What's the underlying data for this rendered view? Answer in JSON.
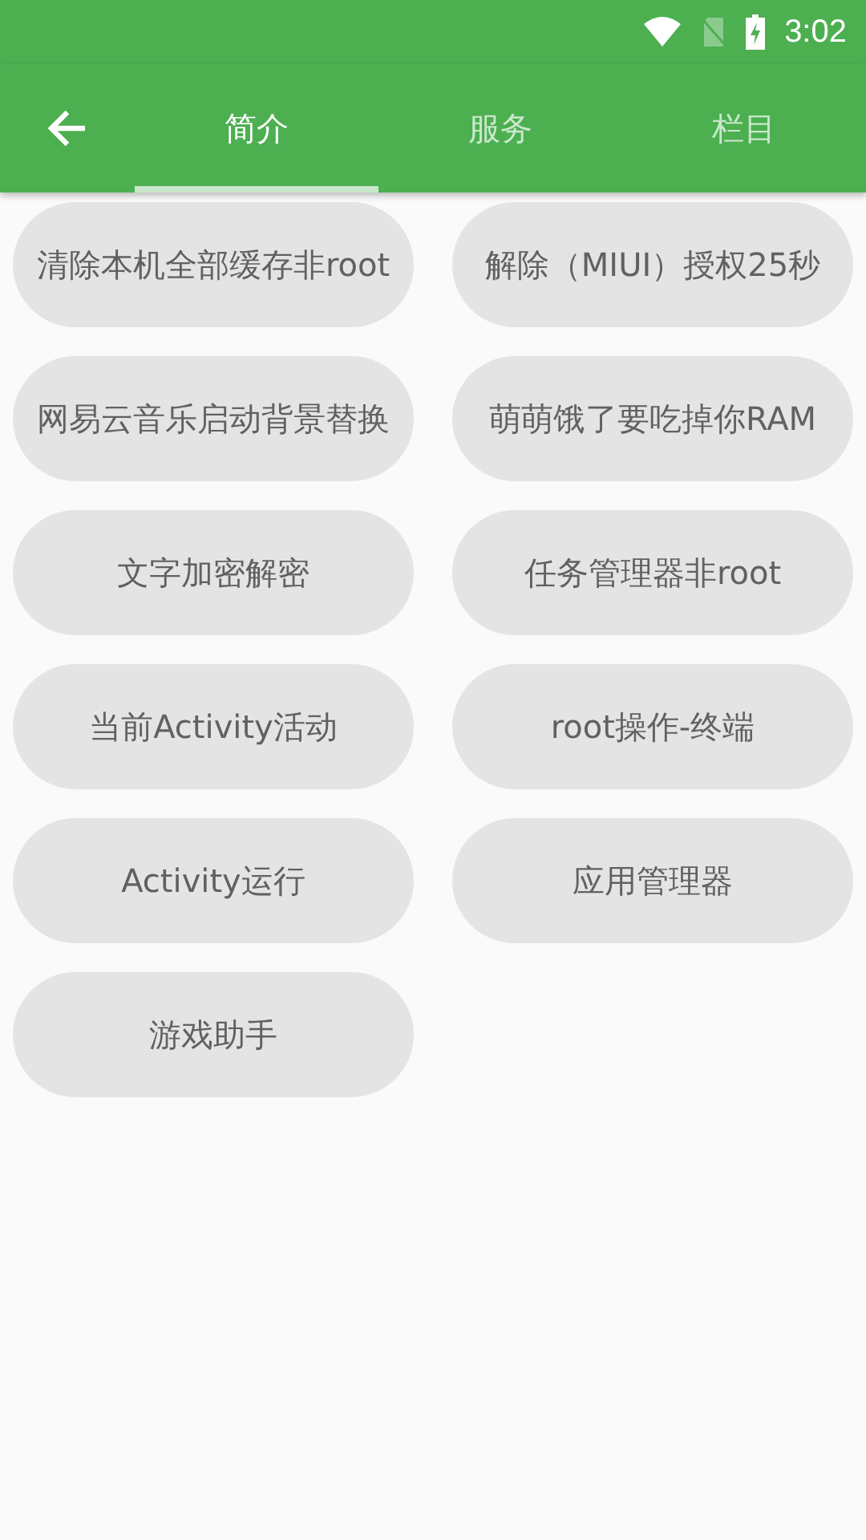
{
  "status_bar": {
    "time": "3:02"
  },
  "tabs": [
    {
      "label": "简介",
      "selected": true
    },
    {
      "label": "服务",
      "selected": false
    },
    {
      "label": "栏目",
      "selected": false
    }
  ],
  "buttons": [
    "清除本机全部缓存非root",
    "解除（MIUI）授权25秒",
    "网易云音乐启动背景替换",
    "萌萌饿了要吃掉你RAM",
    "文字加密解密",
    "任务管理器非root",
    "当前Activity活动",
    "root操作-终端",
    "Activity运行",
    "应用管理器",
    "游戏助手"
  ]
}
